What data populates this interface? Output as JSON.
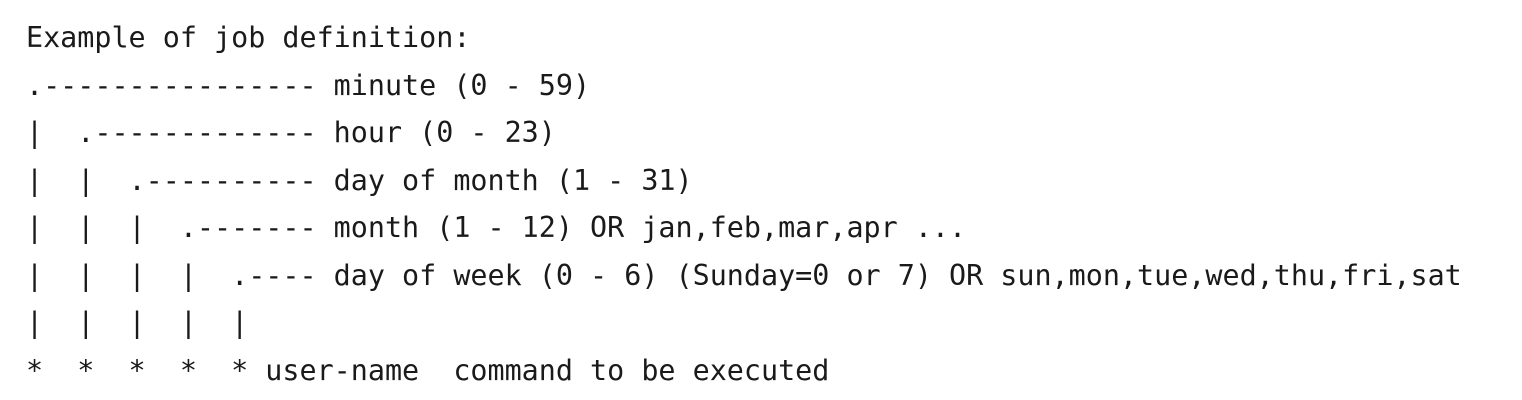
{
  "document": {
    "lines": [
      "Example of job definition:",
      ".---------------- minute (0 - 59)",
      "|  .------------- hour (0 - 23)",
      "|  |  .---------- day of month (1 - 31)",
      "|  |  |  .------- month (1 - 12) OR jan,feb,mar,apr ...",
      "|  |  |  |  .---- day of week (0 - 6) (Sunday=0 or 7) OR sun,mon,tue,wed,thu,fri,sat",
      "|  |  |  |  |",
      "*  *  *  *  * user-name  command to be executed"
    ]
  }
}
